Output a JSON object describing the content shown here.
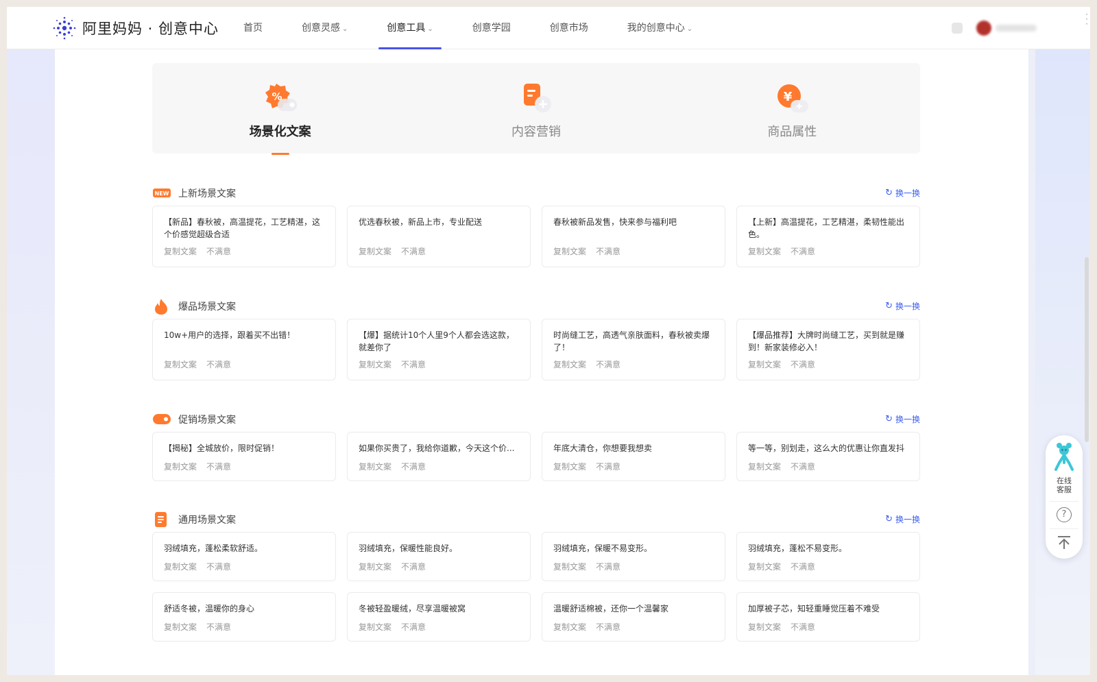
{
  "header": {
    "logo_text": "阿里妈妈 · 创意中心",
    "nav": [
      {
        "label": "首页"
      },
      {
        "label": "创意灵感",
        "caret": "⌄"
      },
      {
        "label": "创意工具",
        "caret": "⌄"
      },
      {
        "label": "创意学园"
      },
      {
        "label": "创意市场"
      },
      {
        "label": "我的创意中心",
        "caret": "⌄"
      }
    ]
  },
  "tabs": [
    {
      "label": "场景化文案",
      "icon": "percent-tag-icon"
    },
    {
      "label": "内容营销",
      "icon": "document-plus-icon"
    },
    {
      "label": "商品属性",
      "icon": "yuan-coin-icon"
    }
  ],
  "copy_label": "复制文案",
  "dislike_label": "不满意",
  "refresh_label": "换一换",
  "sections": [
    {
      "title": "上新场景文案",
      "icon": "new-badge-icon",
      "cards": [
        "【新品】春秋被，高温提花，工艺精湛，这个价感觉超级合适",
        "优选春秋被，新品上市，专业配送",
        "春秋被新品发售，快来参与福利吧",
        "【上新】高温提花，工艺精湛，柔韧性能出色。"
      ]
    },
    {
      "title": "爆品场景文案",
      "icon": "flame-icon",
      "cards": [
        "10w+用户的选择，跟着买不出错！",
        "【爆】据统计10个人里9个人都会选这款，就差你了",
        "时尚缝工艺，高透气亲肤面料，春秋被卖爆了！",
        "【爆品推荐】大牌时尚缝工艺，买到就是赚到！新家装修必入！"
      ]
    },
    {
      "title": "促销场景文案",
      "icon": "promo-tag-icon",
      "cards": [
        "【揭秘】全城放价，限时促销！",
        "如果你买贵了，我给你道歉，今天这个价...",
        "年底大清仓，你想要我想卖",
        "等一等，别划走，这么大的优惠让你直发抖"
      ]
    },
    {
      "title": "通用场景文案",
      "icon": "document-icon",
      "cards": [
        "羽绒填充，蓬松柔软舒适。",
        "羽绒填充，保暖性能良好。",
        "羽绒填充，保暖不易变形。",
        "羽绒填充，蓬松不易变形。",
        "舒适冬被，温暖你的身心",
        "冬被轻盈暖绒，尽享温暖被窝",
        "温暖舒适棉被，还你一个温馨家",
        "加厚被子芯，知轻重睡觉压着不难受"
      ]
    }
  ],
  "float_widget": {
    "service_label_1": "在线",
    "service_label_2": "客服",
    "help_glyph": "?"
  },
  "colors": {
    "accent": "#4a53e8",
    "orange": "#ff7a2e",
    "link": "#3a5df0"
  }
}
